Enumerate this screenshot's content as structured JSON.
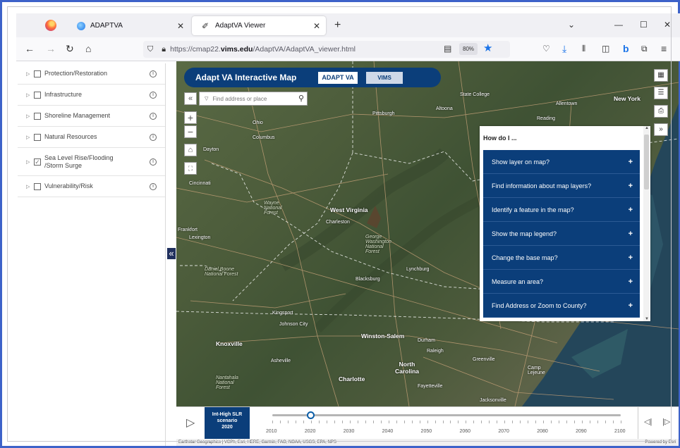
{
  "browser": {
    "tabs": [
      {
        "label": "ADAPTVA"
      },
      {
        "label": "AdaptVA Viewer"
      }
    ],
    "url_prefix": "https://cmap22.",
    "url_domain": "vims.edu",
    "url_path": "/AdaptVA/AdaptVA_viewer.html",
    "zoom": "80%"
  },
  "sidebar": {
    "layers": [
      {
        "label": "Protection/Restoration",
        "checked": false
      },
      {
        "label": "Infrastructure",
        "checked": false
      },
      {
        "label": "Shoreline Management",
        "checked": false
      },
      {
        "label": "Natural Resources",
        "checked": false
      },
      {
        "label": "Sea Level Rise/Flooding /Storm Surge",
        "checked": true
      },
      {
        "label": "Vulnerability/Risk",
        "checked": false
      }
    ]
  },
  "header": {
    "title": "Adapt VA Interactive Map",
    "logo_adapt": "ADAPT VA",
    "logo_vims": "VIMS"
  },
  "search": {
    "placeholder": "Find address or place"
  },
  "howdoi": {
    "title": "How do I ...",
    "items": [
      {
        "label": "Show layer on map?",
        "icon": "+"
      },
      {
        "label": "Find information about map layers?",
        "icon": "+"
      },
      {
        "label": "Identify a feature in the map?",
        "icon": "+"
      },
      {
        "label": "Show the map legend?",
        "icon": "+"
      },
      {
        "label": "Change the base map?",
        "icon": "+"
      },
      {
        "label": "Measure an area?",
        "icon": "+"
      },
      {
        "label": "Find Address or Zoom to County?",
        "icon": "+"
      }
    ]
  },
  "map_labels": {
    "west_virginia": "West Virginia",
    "ohio": "Ohio",
    "pittsburgh": "Pittsburgh",
    "state_college": "State College",
    "allentown": "Allentown",
    "new_york": "New York",
    "columbus": "Columbus",
    "dayton": "Dayton",
    "cincinnati": "Cincinnati",
    "charleston": "Charleston",
    "lexington": "Lexington",
    "frankfort": "Frankfort",
    "lynchburg": "Lynchburg",
    "blacksburg": "Blacksburg",
    "winston_salem": "Winston-Salem",
    "durham": "Durham",
    "raleigh": "Raleigh",
    "knoxville": "Knoxville",
    "asheville": "Asheville",
    "charlotte": "Charlotte",
    "north_carolina": "North Carolina",
    "fayetteville": "Fayetteville",
    "greenville": "Greenville",
    "kingsport": "Kingsport",
    "johnson_city": "Johnson City",
    "reading": "Reading",
    "altoona": "Altoona",
    "wayne_forest": "Wayne National Forest",
    "daniel_boone": "Daniel Boone National Forest",
    "gw_forest": "George Washington National Forest",
    "nantahala": "Nantahala National Forest",
    "camp_lejeune": "Camp Lejeune",
    "jacksonville": "Jacksonville"
  },
  "timeline": {
    "scenario_line1": "Int-High SLR",
    "scenario_line2": "scenario",
    "scenario_year": "2020",
    "years": [
      "2010",
      "2020",
      "2030",
      "2040",
      "2050",
      "2060",
      "2070",
      "2080",
      "2090",
      "2100"
    ],
    "position": 0.111
  },
  "attribution": {
    "text": "Earthstar Geographics | VCPh, Esri, HERE, Garmin, FAO, NOAA, USGS, EPA, NPS",
    "powered": "Powered by Esri"
  }
}
